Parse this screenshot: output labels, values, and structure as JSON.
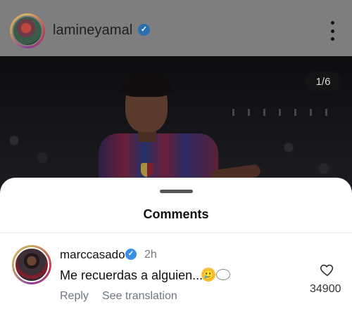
{
  "post": {
    "username": "lamineyamal",
    "page_counter": "1/6",
    "icons": {
      "verified": "verified-badge-icon",
      "more": "more-options-icon"
    }
  },
  "comments_sheet": {
    "title": "Comments",
    "comment": {
      "username": "marccasado",
      "time": "2h",
      "text": "Me recuerdas a alguien...",
      "emoji": "🥲",
      "reply_label": "Reply",
      "translate_label": "See translation",
      "like_count": "34900",
      "icons": {
        "verified": "verified-badge-icon",
        "like": "heart-icon",
        "thought": "thought-bubble-icon"
      }
    }
  },
  "colors": {
    "verified_blue": "#3b8ee6",
    "overlay": "#7e7e7e",
    "secondary_text": "#6f7680"
  }
}
